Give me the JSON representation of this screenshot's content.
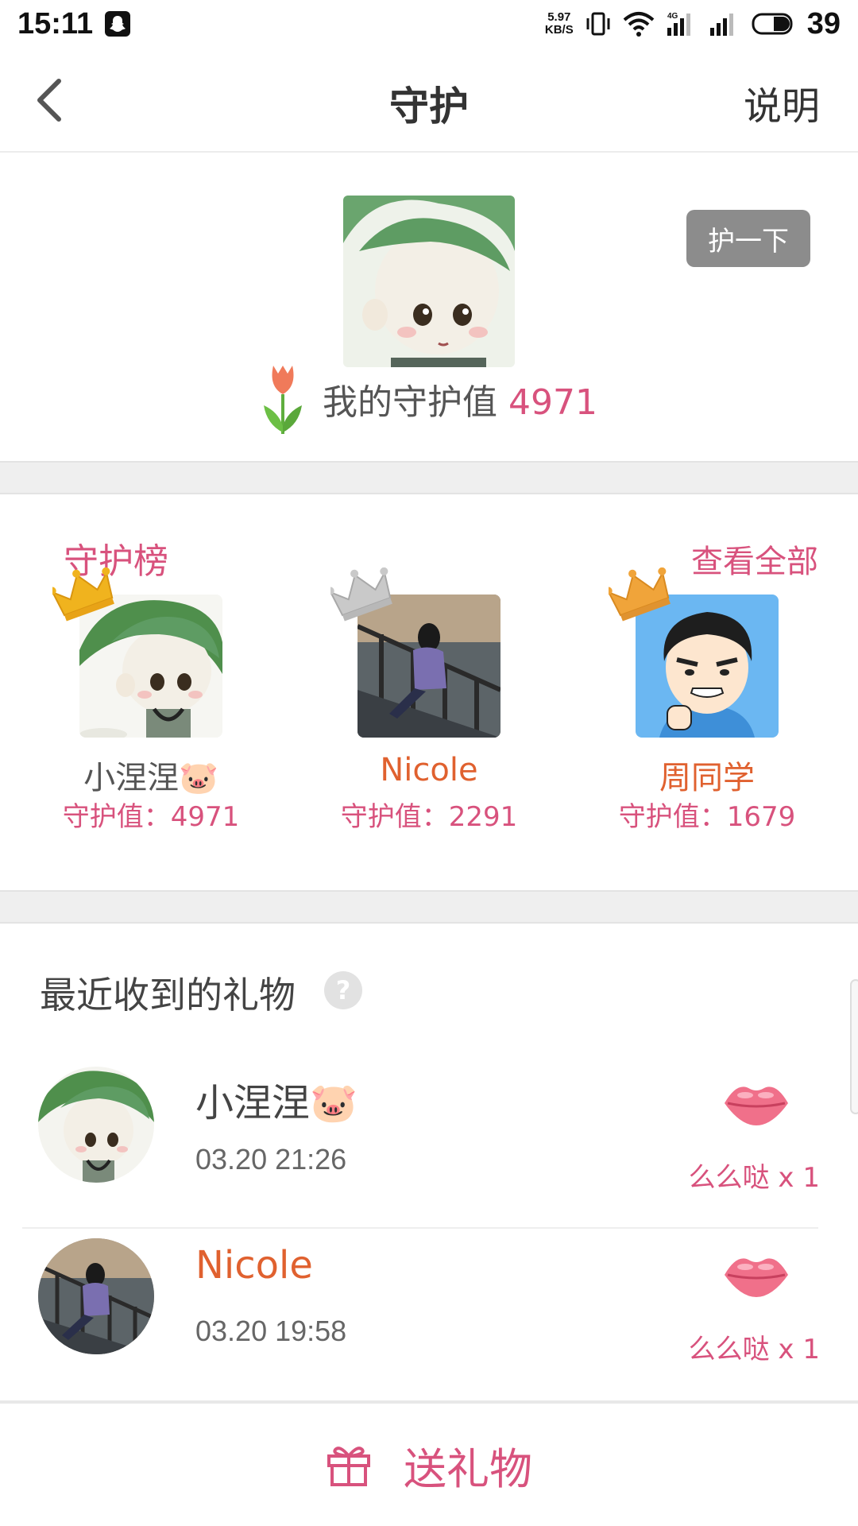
{
  "status_bar": {
    "time": "15:11",
    "net_speed_value": "5.97",
    "net_speed_unit": "KB/S",
    "battery": "39",
    "icons": [
      "snapchat-icon",
      "vibrate-icon",
      "wifi-icon",
      "signal-4g-icon",
      "signal-icon",
      "battery-icon"
    ]
  },
  "nav": {
    "title": "守护",
    "help_label": "说明"
  },
  "profile": {
    "protect_button": "护一下",
    "my_value_label": "我的守护值",
    "my_value": "4971"
  },
  "rank": {
    "title": "守护榜",
    "view_all": "查看全部",
    "items": [
      {
        "name": "小涅涅🐷",
        "score": "守护值：4971",
        "crown": "gold"
      },
      {
        "name": "Nicole",
        "score": "守护值：2291",
        "crown": "silver"
      },
      {
        "name": "周同学",
        "score": "守护值：1679",
        "crown": "bronze"
      }
    ]
  },
  "gifts": {
    "title": "最近收到的礼物",
    "help_icon": "?",
    "rows": [
      {
        "name": "小涅涅🐷",
        "time": "03.20 21:26",
        "gift": "么么哒 x 1"
      },
      {
        "name": "Nicole",
        "time": "03.20 19:58",
        "gift": "么么哒 x 1"
      }
    ]
  },
  "bottom": {
    "send_label": "送礼物"
  },
  "colors": {
    "accent_pink": "#d8527d",
    "accent_orange": "#e0612f",
    "button_gray": "#8c8c8c"
  }
}
